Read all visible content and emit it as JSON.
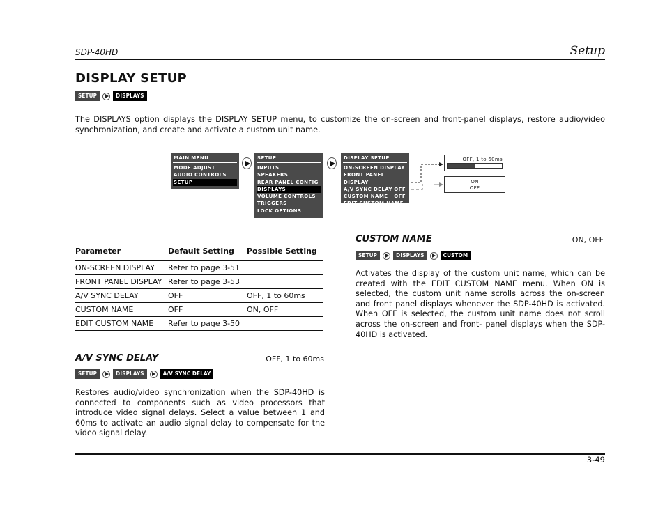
{
  "header": {
    "model": "SDP-40HD",
    "section": "Setup"
  },
  "page": {
    "title": "DISPLAY SETUP",
    "number": "3-49"
  },
  "breadcrumb_main": [
    "SETUP",
    "DISPLAYS"
  ],
  "intro": "The DISPLAYS option displays the DISPLAY SETUP menu, to customize the on-screen and front-panel displays, restore audio/video synchronization, and create and activate a custom unit name.",
  "diagram": {
    "main_menu": {
      "title": "MAIN MENU",
      "items": [
        "MODE ADJUST",
        "AUDIO CONTROLS",
        "SETUP"
      ],
      "selected_index": 2
    },
    "setup_menu": {
      "title": "SETUP",
      "items": [
        "INPUTS",
        "SPEAKERS",
        "REAR PANEL CONFIG",
        "DISPLAYS",
        "VOLUME CONTROLS",
        "TRIGGERS",
        "LOCK OPTIONS"
      ],
      "selected_index": 3
    },
    "display_setup_menu": {
      "title": "DISPLAY SETUP",
      "items": [
        {
          "label": "ON-SCREEN DISPLAY",
          "value": ""
        },
        {
          "label": "FRONT PANEL DISPLAY",
          "value": ""
        },
        {
          "label": "A/V SYNC DELAY",
          "value": "OFF"
        },
        {
          "label": "CUSTOM NAME",
          "value": "OFF"
        },
        {
          "label": "EDIT CUSTOM NAME",
          "value": ""
        }
      ]
    },
    "sync_option": {
      "label": "OFF, 1 to 60ms",
      "bar_fill_fraction": 0.5
    },
    "custom_option": {
      "lines": [
        "ON",
        "OFF"
      ]
    }
  },
  "table": {
    "headers": [
      "Parameter",
      "Default Setting",
      "Possible Setting"
    ],
    "rows": [
      [
        "ON-SCREEN DISPLAY",
        "Refer to page 3-51",
        ""
      ],
      [
        "FRONT PANEL DISPLAY",
        "Refer to page 3-53",
        ""
      ],
      [
        "A/V SYNC DELAY",
        "OFF",
        "OFF, 1 to 60ms"
      ],
      [
        "CUSTOM NAME",
        "OFF",
        "ON, OFF"
      ],
      [
        "EDIT CUSTOM NAME",
        "Refer to page 3-50",
        ""
      ]
    ]
  },
  "av_sync": {
    "title": "A/V SYNC DELAY",
    "range": "OFF, 1 to 60ms",
    "breadcrumb": [
      "SETUP",
      "DISPLAYS",
      "A/V SYNC DELAY"
    ],
    "body": "Restores audio/video synchronization when the SDP-40HD is connected to components such as video processors that introduce video signal delays. Select a value between 1 and 60ms to activate an audio signal delay to compensate for the video signal delay."
  },
  "custom_name": {
    "title": "CUSTOM NAME",
    "range": "ON, OFF",
    "breadcrumb": [
      "SETUP",
      "DISPLAYS",
      "CUSTOM"
    ],
    "body": "Activates the display of the custom unit name, which can be created with the EDIT CUSTOM NAME menu. When ON is selected, the custom unit name scrolls across the on-screen and front panel displays whenever the SDP-40HD is activated. When OFF is selected, the custom unit name does not scroll across the on-screen and front- panel displays when the SDP-40HD is activated."
  }
}
